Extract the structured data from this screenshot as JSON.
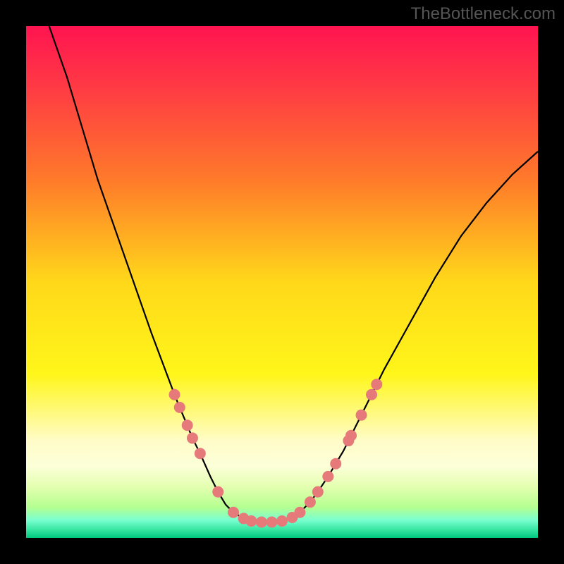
{
  "watermark": "TheBottleneck.com",
  "chart_data": {
    "type": "line",
    "title": "",
    "xlabel": "",
    "ylabel": "",
    "xlim": [
      0,
      100
    ],
    "ylim": [
      0,
      100
    ],
    "background_gradient": {
      "stops": [
        {
          "offset": 0.0,
          "color": "#ff1450"
        },
        {
          "offset": 0.12,
          "color": "#ff3a44"
        },
        {
          "offset": 0.3,
          "color": "#ff7a2a"
        },
        {
          "offset": 0.5,
          "color": "#ffd81a"
        },
        {
          "offset": 0.68,
          "color": "#fff61a"
        },
        {
          "offset": 0.81,
          "color": "#fffcc8"
        },
        {
          "offset": 0.86,
          "color": "#fcffd8"
        },
        {
          "offset": 0.9,
          "color": "#e4ffb0"
        },
        {
          "offset": 0.94,
          "color": "#b4ff90"
        },
        {
          "offset": 0.965,
          "color": "#7affd0"
        },
        {
          "offset": 0.985,
          "color": "#33e49f"
        },
        {
          "offset": 1.0,
          "color": "#00c880"
        }
      ]
    },
    "curve": [
      {
        "x": 4.5,
        "y": 100.0
      },
      {
        "x": 8.0,
        "y": 90.0
      },
      {
        "x": 11.0,
        "y": 80.0
      },
      {
        "x": 14.0,
        "y": 70.0
      },
      {
        "x": 17.5,
        "y": 60.0
      },
      {
        "x": 21.0,
        "y": 50.0
      },
      {
        "x": 24.5,
        "y": 40.0
      },
      {
        "x": 27.5,
        "y": 32.0
      },
      {
        "x": 29.0,
        "y": 28.0
      },
      {
        "x": 30.0,
        "y": 25.5
      },
      {
        "x": 31.5,
        "y": 22.0
      },
      {
        "x": 32.5,
        "y": 19.5
      },
      {
        "x": 34.0,
        "y": 16.5
      },
      {
        "x": 36.0,
        "y": 12.0
      },
      {
        "x": 37.5,
        "y": 9.0
      },
      {
        "x": 39.0,
        "y": 6.5
      },
      {
        "x": 40.5,
        "y": 5.0
      },
      {
        "x": 42.5,
        "y": 3.8
      },
      {
        "x": 44.0,
        "y": 3.3
      },
      {
        "x": 46.0,
        "y": 3.1
      },
      {
        "x": 48.0,
        "y": 3.1
      },
      {
        "x": 50.0,
        "y": 3.3
      },
      {
        "x": 52.0,
        "y": 4.0
      },
      {
        "x": 53.5,
        "y": 5.0
      },
      {
        "x": 55.5,
        "y": 7.0
      },
      {
        "x": 57.0,
        "y": 9.0
      },
      {
        "x": 59.0,
        "y": 12.0
      },
      {
        "x": 60.5,
        "y": 14.5
      },
      {
        "x": 62.0,
        "y": 17.0
      },
      {
        "x": 63.0,
        "y": 19.0
      },
      {
        "x": 63.5,
        "y": 20.0
      },
      {
        "x": 65.5,
        "y": 24.0
      },
      {
        "x": 67.5,
        "y": 28.0
      },
      {
        "x": 68.5,
        "y": 30.0
      },
      {
        "x": 70.0,
        "y": 33.0
      },
      {
        "x": 75.0,
        "y": 42.0
      },
      {
        "x": 80.0,
        "y": 51.0
      },
      {
        "x": 85.0,
        "y": 59.0
      },
      {
        "x": 90.0,
        "y": 65.5
      },
      {
        "x": 95.0,
        "y": 71.0
      },
      {
        "x": 100.0,
        "y": 75.5
      }
    ],
    "markers": [
      {
        "x": 29.0,
        "y": 28.0
      },
      {
        "x": 30.0,
        "y": 25.5
      },
      {
        "x": 31.5,
        "y": 22.0
      },
      {
        "x": 32.5,
        "y": 19.5
      },
      {
        "x": 34.0,
        "y": 16.5
      },
      {
        "x": 37.5,
        "y": 9.0
      },
      {
        "x": 40.5,
        "y": 5.0
      },
      {
        "x": 42.5,
        "y": 3.8
      },
      {
        "x": 44.0,
        "y": 3.3
      },
      {
        "x": 46.0,
        "y": 3.1
      },
      {
        "x": 48.0,
        "y": 3.1
      },
      {
        "x": 50.0,
        "y": 3.3
      },
      {
        "x": 52.0,
        "y": 4.0
      },
      {
        "x": 53.5,
        "y": 5.0
      },
      {
        "x": 55.5,
        "y": 7.0
      },
      {
        "x": 57.0,
        "y": 9.0
      },
      {
        "x": 59.0,
        "y": 12.0
      },
      {
        "x": 60.5,
        "y": 14.5
      },
      {
        "x": 63.0,
        "y": 19.0
      },
      {
        "x": 63.5,
        "y": 20.0
      },
      {
        "x": 65.5,
        "y": 24.0
      },
      {
        "x": 67.5,
        "y": 28.0
      },
      {
        "x": 68.5,
        "y": 30.0
      }
    ],
    "colors": {
      "curve_stroke": "#000000",
      "marker_fill": "#e67a7a",
      "frame_bg": "#000000"
    }
  }
}
